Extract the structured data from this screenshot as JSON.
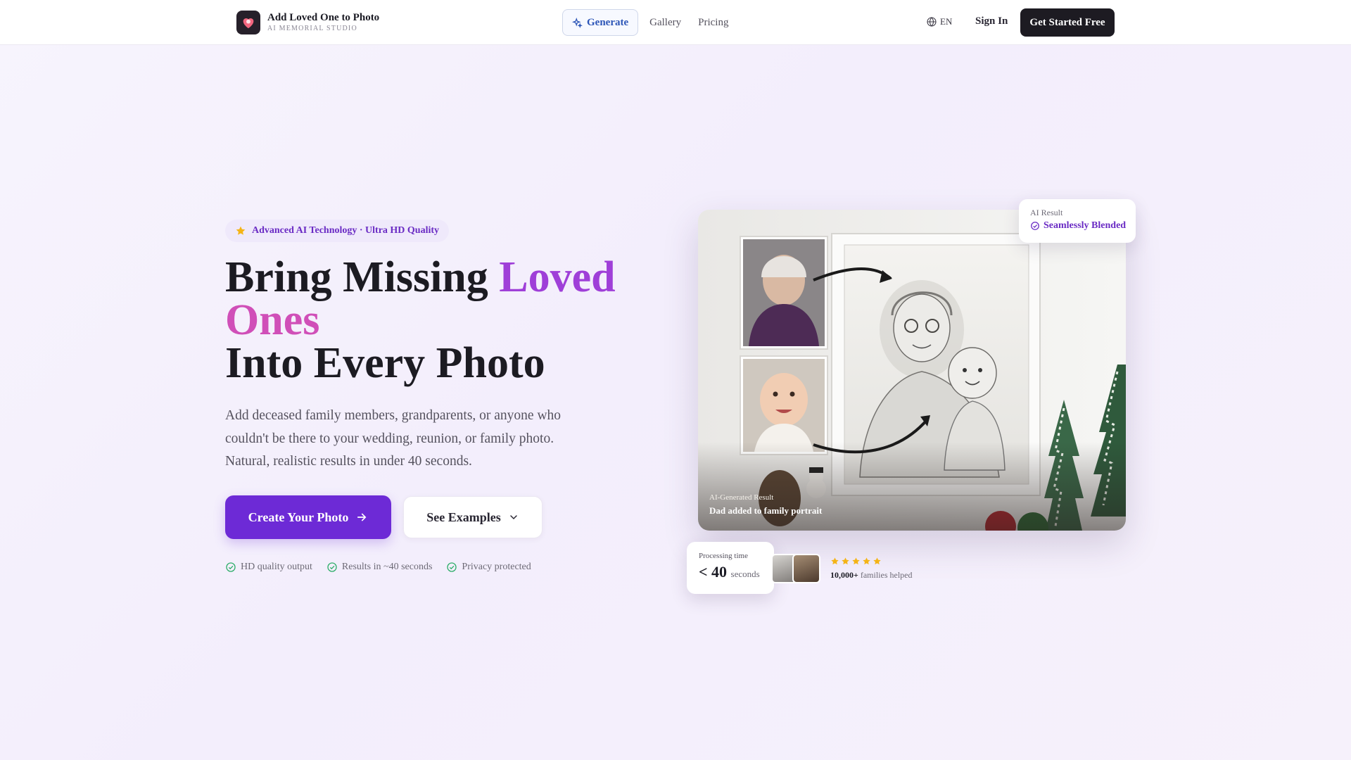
{
  "nav": {
    "brand_title": "Add Loved One to Photo",
    "brand_subtitle": "AI MEMORIAL STUDIO",
    "links": {
      "generate": "Generate",
      "gallery": "Gallery",
      "pricing": "Pricing"
    },
    "language": "EN",
    "sign_in": "Sign In",
    "cta": "Get Started Free"
  },
  "hero": {
    "badge": "Advanced AI Technology · Ultra HD Quality",
    "title_line1": "Bring Missing ",
    "title_accent1": "Loved",
    "title_accent2": "Ones",
    "title_line3": "Into Every Photo",
    "subtitle": "Add deceased family members, grandparents, or anyone who couldn't be there to your wedding, reunion, or family photo. Natural, realistic results in under 40 seconds.",
    "primary_button": "Create Your Photo",
    "secondary_button": "See Examples",
    "features": [
      "HD quality output",
      "Results in ~40 seconds",
      "Privacy protected"
    ]
  },
  "showcase": {
    "caption_small": "AI-Generated Result",
    "caption_big": "Dad added to family portrait",
    "ai_card": {
      "label": "AI Result",
      "value": "Seamlessly Blended"
    },
    "processing": {
      "label": "Processing time",
      "value": "< 40",
      "unit": "seconds"
    },
    "rating_stars": 5,
    "families_count": "10,000+",
    "families_text": " families helped"
  },
  "colors": {
    "accent_purple": "#6d2ad6",
    "title_purple": "#9f3fd8",
    "title_pink": "#d04fb8",
    "check_green": "#2fae6a",
    "star_gold": "#f4b416"
  }
}
